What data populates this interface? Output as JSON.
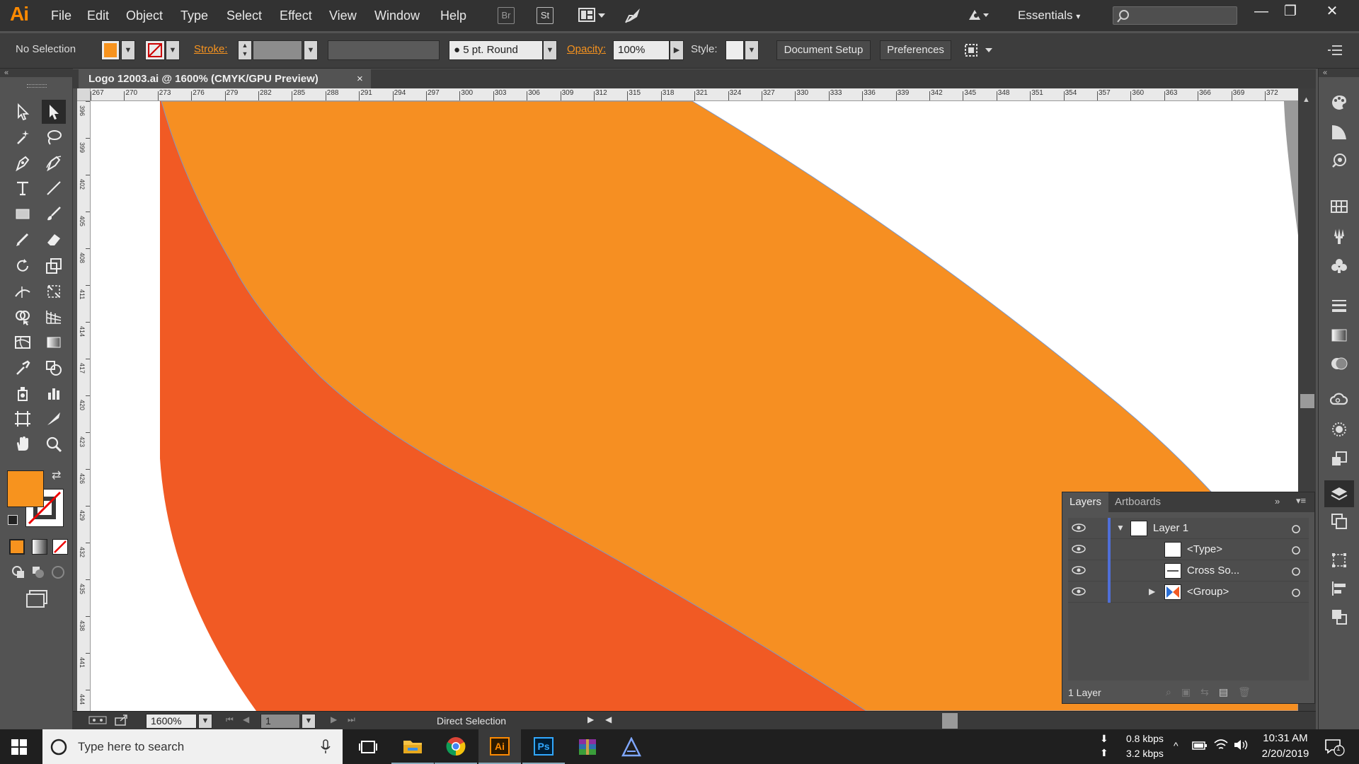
{
  "app": {
    "logo": "Ai",
    "menu": [
      "File",
      "Edit",
      "Object",
      "Type",
      "Select",
      "Effect",
      "View",
      "Window",
      "Help"
    ],
    "bridge_badge": "Br",
    "stock_badge": "St",
    "workspace": "Essentials",
    "window_controls": {
      "minimize": "—",
      "restore": "❐",
      "close": "✕"
    }
  },
  "control_bar": {
    "selection": "No Selection",
    "fill_color": "#f7931e",
    "stroke_label": "Stroke:",
    "brush": "5 pt. Round",
    "opacity_label": "Opacity:",
    "opacity_value": "100%",
    "style_label": "Style:",
    "document_setup": "Document Setup",
    "preferences": "Preferences"
  },
  "document": {
    "tab_title": "Logo 12003.ai @ 1600% (CMYK/GPU Preview)",
    "close": "×",
    "h_ruler": [
      "267",
      "270",
      "273",
      "276",
      "279",
      "282",
      "285",
      "288",
      "291",
      "294",
      "297",
      "300",
      "303",
      "306",
      "309",
      "312",
      "315",
      "318",
      "321",
      "324",
      "327",
      "330",
      "333",
      "336",
      "339",
      "342",
      "345",
      "348",
      "351",
      "354",
      "357",
      "360",
      "363",
      "366",
      "369",
      "372"
    ],
    "v_ruler": [
      "396",
      "399",
      "402",
      "405",
      "408",
      "411",
      "414",
      "417",
      "420",
      "423",
      "426",
      "429",
      "432",
      "435",
      "438",
      "441",
      "444"
    ],
    "colors": {
      "light_orange": "#f68f22",
      "dark_orange": "#f15a24",
      "white": "#ffffff"
    }
  },
  "status_bar": {
    "zoom": "1600%",
    "page": "1",
    "tool": "Direct Selection"
  },
  "toolbar": {
    "fill": "#f7931e",
    "stroke": "none"
  },
  "layers_panel": {
    "tabs": [
      "Layers",
      "Artboards"
    ],
    "rows": [
      {
        "name": "Layer 1"
      },
      {
        "name": "<Type>"
      },
      {
        "name": "Cross So..."
      },
      {
        "name": "<Group>"
      }
    ],
    "footer": "1 Layer"
  },
  "taskbar": {
    "search_placeholder": "Type here to search",
    "net_down": "0.8 kbps",
    "net_up": "3.2 kbps",
    "time": "10:31 AM",
    "date": "2/20/2019",
    "notifications": "1"
  }
}
